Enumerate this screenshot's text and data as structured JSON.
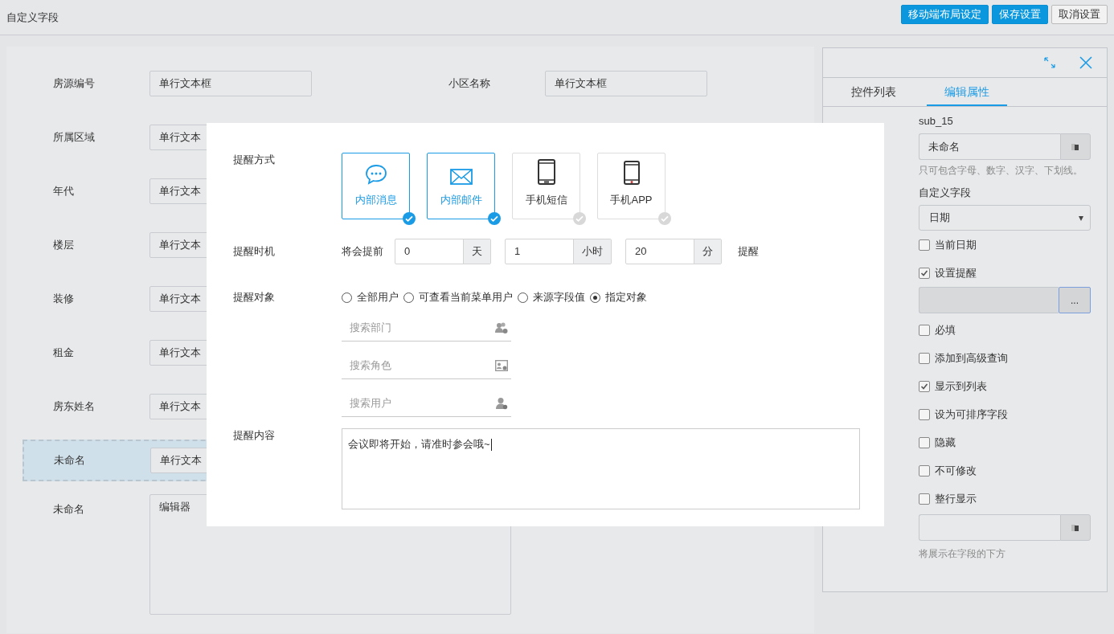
{
  "header": {
    "title": "自定义字段",
    "buttons": [
      {
        "label": "移动端布局设定",
        "kind": "primary"
      },
      {
        "label": "保存设置",
        "kind": "primary"
      },
      {
        "label": "取消设置",
        "kind": "default"
      }
    ]
  },
  "form": {
    "rows": [
      {
        "selected": false,
        "fields": [
          {
            "label": "房源编号",
            "value": "单行文本框",
            "kind": "text"
          },
          {
            "label": "小区名称",
            "value": "单行文本框",
            "kind": "text"
          }
        ]
      },
      {
        "selected": false,
        "fields": [
          {
            "label": "所属区域",
            "value": "单行文本",
            "kind": "text"
          }
        ]
      },
      {
        "selected": false,
        "fields": [
          {
            "label": "年代",
            "value": "单行文本",
            "kind": "text"
          }
        ]
      },
      {
        "selected": false,
        "fields": [
          {
            "label": "楼层",
            "value": "单行文本",
            "kind": "text"
          }
        ]
      },
      {
        "selected": false,
        "fields": [
          {
            "label": "装修",
            "value": "单行文本",
            "kind": "text"
          }
        ]
      },
      {
        "selected": false,
        "fields": [
          {
            "label": "租金",
            "value": "单行文本",
            "kind": "text"
          }
        ]
      },
      {
        "selected": false,
        "fields": [
          {
            "label": "房东姓名",
            "value": "单行文本",
            "kind": "text"
          }
        ]
      },
      {
        "selected": true,
        "fields": [
          {
            "label": "未命名",
            "value": "单行文本",
            "kind": "text"
          }
        ]
      },
      {
        "selected": false,
        "fields": [
          {
            "label": "未命名",
            "value": "编辑器",
            "kind": "editor"
          }
        ]
      }
    ]
  },
  "panel": {
    "tabs": [
      {
        "label": "控件列表",
        "selected": false
      },
      {
        "label": "编辑属性",
        "selected": true
      }
    ],
    "id_value": "sub_15",
    "name_value": "未命名",
    "name_hint": "只可包含字母、数字、汉字、下划线。",
    "type_label": "自定义字段",
    "type_value": "日期",
    "options": [
      {
        "kind": "checkbox",
        "label": "当前日期",
        "checked": false
      },
      {
        "kind": "checkbox",
        "label": "设置提醒",
        "checked": true
      },
      {
        "kind": "picker",
        "button": "..."
      },
      {
        "kind": "checkbox",
        "label": "必填",
        "checked": false
      },
      {
        "kind": "checkbox",
        "label": "添加到高级查询",
        "checked": false
      },
      {
        "kind": "checkbox",
        "label": "显示到列表",
        "checked": true
      },
      {
        "kind": "checkbox",
        "label": "设为可排序字段",
        "checked": false
      },
      {
        "kind": "checkbox",
        "label": "隐藏",
        "checked": false
      },
      {
        "kind": "checkbox",
        "label": "不可修改",
        "checked": false
      },
      {
        "kind": "checkbox",
        "label": "整行显示",
        "checked": false
      }
    ],
    "desc_hint": "将展示在字段的下方"
  },
  "modal": {
    "method_label": "提醒方式",
    "methods": [
      {
        "label": "内部消息",
        "kind": "chat",
        "selected": true
      },
      {
        "label": "内部邮件",
        "kind": "mail",
        "selected": true
      },
      {
        "label": "手机短信",
        "kind": "tablet",
        "selected": false
      },
      {
        "label": "手机APP",
        "kind": "phone",
        "selected": false
      }
    ],
    "timing_label": "提醒时机",
    "timing_prefix": "将会提前",
    "timing": [
      {
        "value": "0",
        "unit": "天"
      },
      {
        "value": "1",
        "unit": "小时"
      },
      {
        "value": "20",
        "unit": "分"
      }
    ],
    "timing_suffix": "提醒",
    "target_label": "提醒对象",
    "targets": [
      {
        "label": "全部用户",
        "selected": false
      },
      {
        "label": "可查看当前菜单用户",
        "selected": false
      },
      {
        "label": "来源字段值",
        "selected": false
      },
      {
        "label": "指定对象",
        "selected": true
      }
    ],
    "searches": [
      {
        "placeholder": "搜索部门",
        "kind": "group"
      },
      {
        "placeholder": "搜索角色",
        "kind": "card"
      },
      {
        "placeholder": "搜索用户",
        "kind": "user"
      }
    ],
    "content_label": "提醒内容",
    "content": "会议即将开始，请准时参会哦~"
  }
}
